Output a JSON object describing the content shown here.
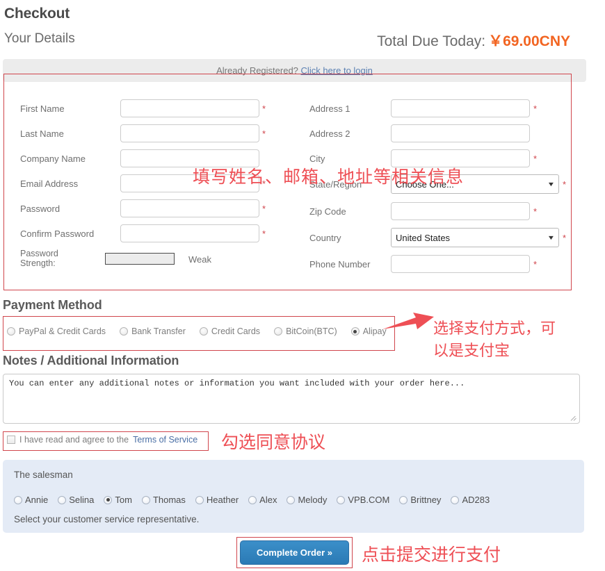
{
  "header": {
    "title": "Checkout",
    "subtitle": "Your Details",
    "total_label": "Total Due Today:",
    "total_amount": "￥69.00CNY",
    "accent_color": "#f26522"
  },
  "registered": {
    "text": "Already Registered?",
    "link": "Click here to login",
    "link_color": "#5b80b2"
  },
  "form": {
    "required_mark": "*",
    "left_fields": [
      {
        "label": "First Name",
        "value": "",
        "required": true
      },
      {
        "label": "Last Name",
        "value": "",
        "required": true
      },
      {
        "label": "Company Name",
        "value": "",
        "required": false
      },
      {
        "label": "Email Address",
        "value": "",
        "required": true
      },
      {
        "label": "Password",
        "value": "",
        "required": true
      },
      {
        "label": "Confirm Password",
        "value": "",
        "required": true
      }
    ],
    "password_strength": {
      "label_line1": "Password",
      "label_line2": "Strength:",
      "value_text": "Weak"
    },
    "right_fields": [
      {
        "label": "Address 1",
        "type": "text",
        "value": "",
        "required": true
      },
      {
        "label": "Address 2",
        "type": "text",
        "value": "",
        "required": false
      },
      {
        "label": "City",
        "type": "text",
        "value": "",
        "required": true
      },
      {
        "label": "State/Region",
        "type": "select",
        "value": "Choose One...",
        "required": true
      },
      {
        "label": "Zip Code",
        "type": "text",
        "value": "",
        "required": true
      },
      {
        "label": "Country",
        "type": "select",
        "value": "United States",
        "required": true
      },
      {
        "label": "Phone Number",
        "type": "text",
        "value": "",
        "required": true
      }
    ]
  },
  "payment": {
    "heading": "Payment Method",
    "options": [
      {
        "label": "PayPal & Credit Cards",
        "selected": false
      },
      {
        "label": "Bank Transfer",
        "selected": false
      },
      {
        "label": "Credit Cards",
        "selected": false
      },
      {
        "label": "BitCoin(BTC)",
        "selected": false
      },
      {
        "label": "Alipay",
        "selected": true
      }
    ]
  },
  "notes": {
    "heading": "Notes / Additional Information",
    "value": "You can enter any additional notes or information you want included with your order here..."
  },
  "terms": {
    "checked": false,
    "text": "I have read and agree to the",
    "link": "Terms of Service"
  },
  "salesman": {
    "title": "The salesman",
    "footer": "Select your customer service representative.",
    "options": [
      {
        "label": "Annie",
        "selected": false
      },
      {
        "label": "Selina",
        "selected": false
      },
      {
        "label": "Tom",
        "selected": true
      },
      {
        "label": "Thomas",
        "selected": false
      },
      {
        "label": "Heather",
        "selected": false
      },
      {
        "label": "Alex",
        "selected": false
      },
      {
        "label": "Melody",
        "selected": false
      },
      {
        "label": "VPB.COM",
        "selected": false
      },
      {
        "label": "Brittney",
        "selected": false
      },
      {
        "label": "AD283",
        "selected": false
      }
    ]
  },
  "submit": {
    "label": "Complete Order »"
  },
  "annotations": {
    "color": "#ee4f55",
    "form": "填写姓名、邮箱、地址等相关信息",
    "payment": "选择支付方式，可\n以是支付宝",
    "terms": "勾选同意协议",
    "submit": "点击提交进行支付"
  }
}
